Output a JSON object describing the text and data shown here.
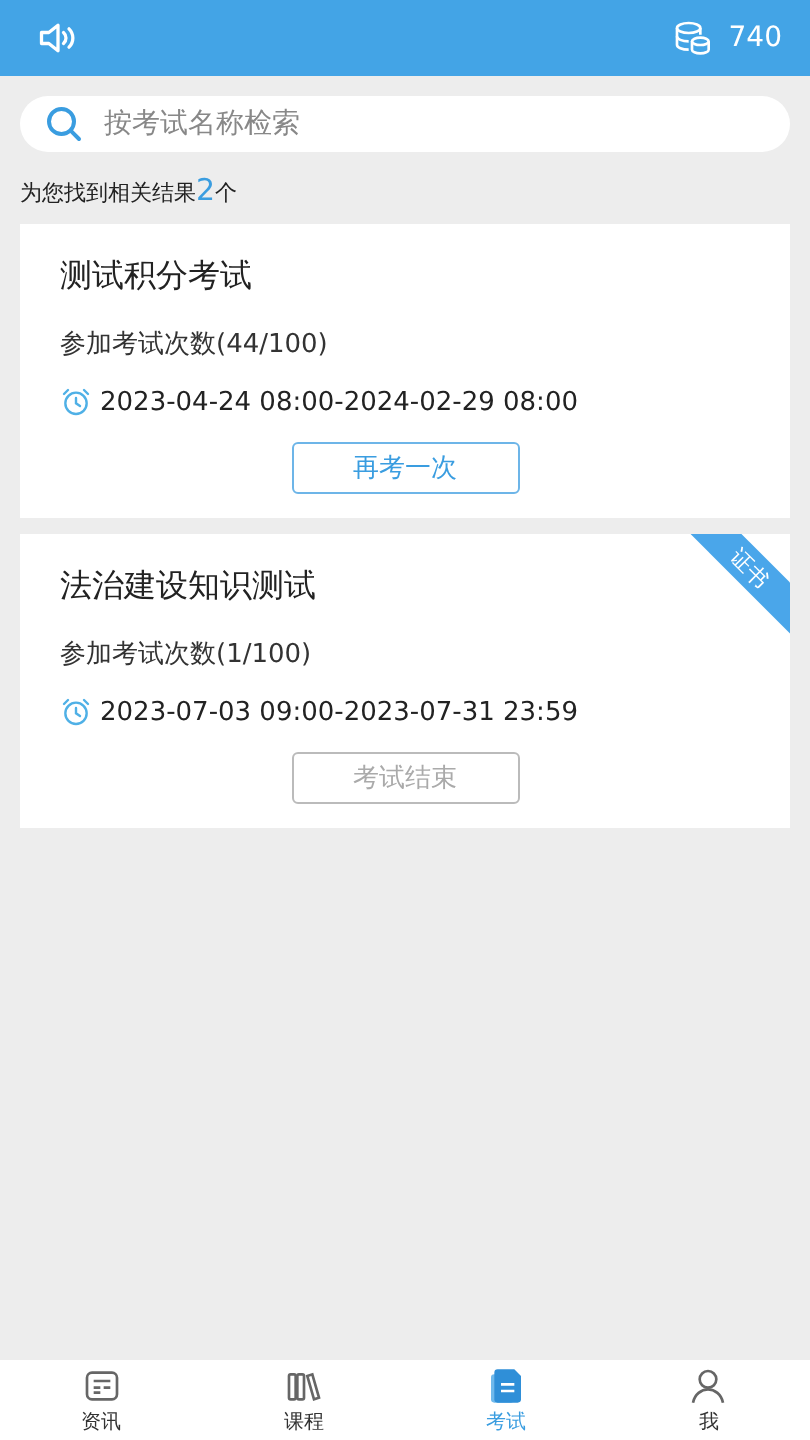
{
  "header": {
    "points": "740"
  },
  "search": {
    "placeholder": "按考试名称检索"
  },
  "result": {
    "prefix": "为您找到相关结果",
    "count": "2",
    "suffix": "个"
  },
  "exams": [
    {
      "title": "测试积分考试",
      "attempts": "参加考试次数(44/100)",
      "period": "2023-04-24 08:00-2024-02-29 08:00",
      "button": {
        "label": "再考一次",
        "disabled": false
      }
    },
    {
      "title": "法治建设知识测试",
      "attempts": "参加考试次数(1/100)",
      "period": "2023-07-03 09:00-2023-07-31 23:59",
      "button": {
        "label": "考试结束",
        "disabled": true
      },
      "certificate": "证书"
    }
  ],
  "tabs": [
    {
      "label": "资讯",
      "selected": false
    },
    {
      "label": "课程",
      "selected": false
    },
    {
      "label": "考试",
      "selected": true
    },
    {
      "label": "我",
      "selected": false
    }
  ]
}
